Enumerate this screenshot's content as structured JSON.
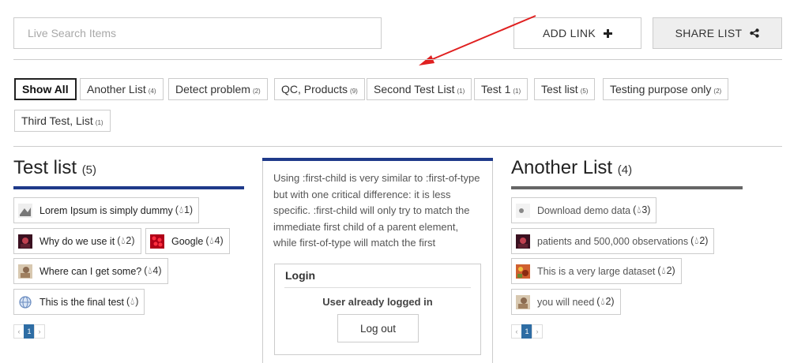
{
  "search": {
    "placeholder": "Live Search Items",
    "value": ""
  },
  "toolbar": {
    "add_link_label": "ADD LINK",
    "share_list_label": "SHARE LIST"
  },
  "filters": [
    {
      "label": "Show All",
      "count": "",
      "active": true
    },
    {
      "label": "Another List",
      "count": "(4)"
    },
    {
      "label": "Detect problem",
      "count": "(2)"
    },
    {
      "label": "QC, Products",
      "count": "(9)"
    },
    {
      "label": "Second Test List",
      "count": "(1)"
    },
    {
      "label": "Test 1",
      "count": "(1)"
    },
    {
      "label": "Test list",
      "count": "(5)"
    },
    {
      "label": "Testing purpose only",
      "count": "(2)"
    },
    {
      "label": "Third Test, List",
      "count": "(1)"
    }
  ],
  "left_column": {
    "title": "Test list",
    "count": "(5)",
    "accent": "#1f3a8a",
    "items": [
      {
        "label": "Lorem Ipsum is simply dummy",
        "count": "1)",
        "icon": "image-thumb"
      },
      {
        "label": "Why do we use it",
        "count": "2)",
        "icon": "image-thumb"
      },
      {
        "label": "Google",
        "count": "4)",
        "icon": "image-thumb"
      },
      {
        "label": "Where can I get some?",
        "count": "4)",
        "icon": "image-thumb"
      },
      {
        "label": "This is the final test",
        "count": ")",
        "icon": "globe-icon"
      }
    ],
    "pager": {
      "prev": "‹",
      "page": "1",
      "next": "›"
    }
  },
  "middle_column": {
    "accent": "#1f3a8a",
    "text": "Using :first-child is very similar to :first-of-type but with one critical difference: it is less specific. :first-child will only try to match the immediate first child of a parent element, while first-of-type will match the first",
    "login": {
      "title": "Login",
      "message": "User already logged in",
      "button": "Log out"
    }
  },
  "right_column": {
    "title": "Another List",
    "count": "(4)",
    "accent": "#666666",
    "items": [
      {
        "label": "Download demo data",
        "count": "3)",
        "icon": "image-thumb"
      },
      {
        "label": "patients and 500,000 observations",
        "count": "2)",
        "icon": "image-thumb"
      },
      {
        "label": "This is a very large dataset",
        "count": "2)",
        "icon": "image-thumb"
      },
      {
        "label": "you will need",
        "count": "2)",
        "icon": "image-thumb"
      }
    ],
    "pager": {
      "prev": "‹",
      "page": "1",
      "next": "›"
    }
  }
}
